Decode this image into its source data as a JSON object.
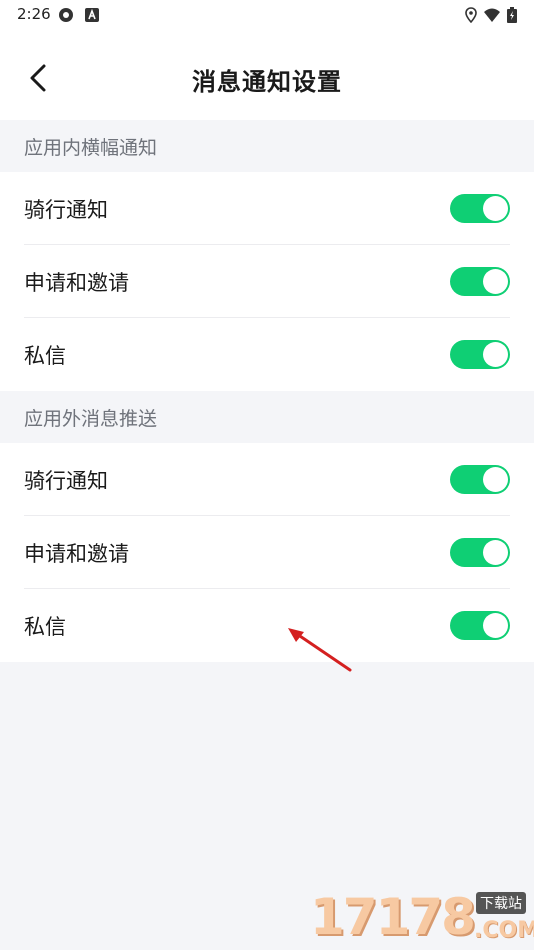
{
  "status_bar": {
    "time": "2:26"
  },
  "header": {
    "title": "消息通知设置"
  },
  "sections": [
    {
      "title": "应用内横幅通知",
      "items": [
        {
          "label": "骑行通知",
          "on": true
        },
        {
          "label": "申请和邀请",
          "on": true
        },
        {
          "label": "私信",
          "on": true
        }
      ]
    },
    {
      "title": "应用外消息推送",
      "items": [
        {
          "label": "骑行通知",
          "on": true
        },
        {
          "label": "申请和邀请",
          "on": true
        },
        {
          "label": "私信",
          "on": true
        }
      ]
    }
  ],
  "colors": {
    "toggle_on": "#0fcf74",
    "background": "#f4f5f8",
    "annotation_arrow": "#d42020"
  },
  "watermark": {
    "digits": "17178",
    "tag": "下载站",
    "suffix": ".COM"
  }
}
